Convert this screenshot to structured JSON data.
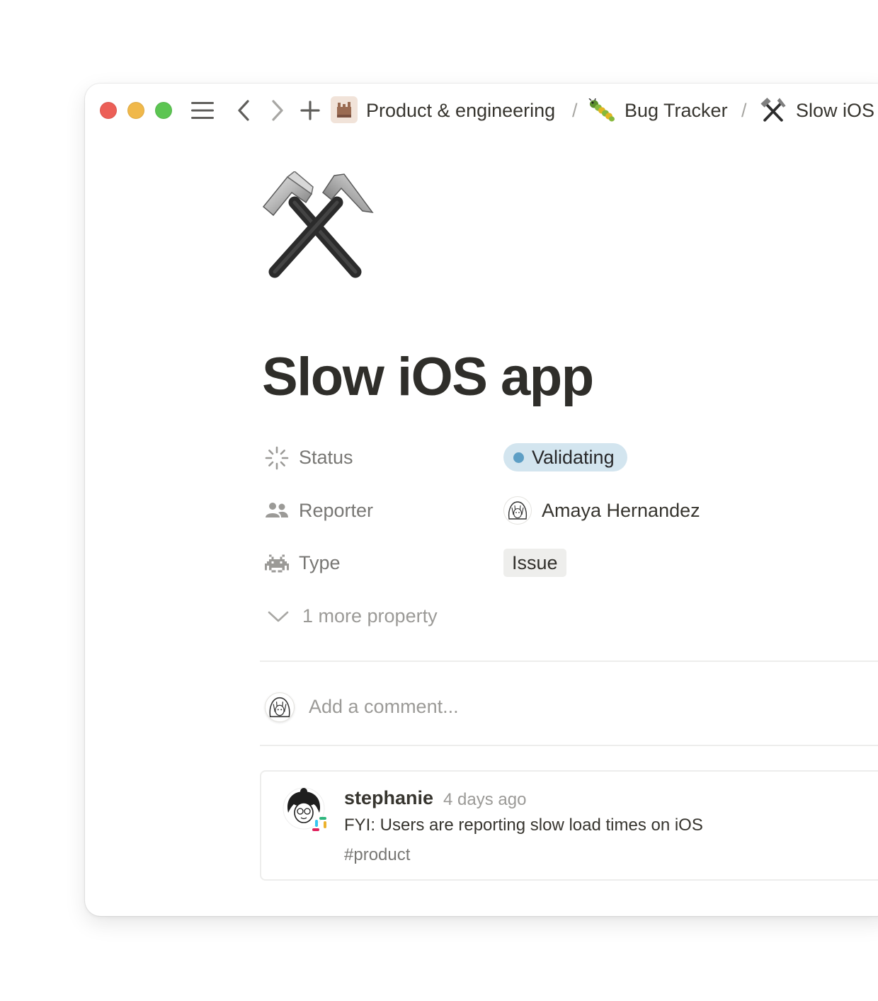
{
  "window": {
    "controls": [
      "close",
      "minimize",
      "zoom"
    ]
  },
  "toolbar": {
    "icons": [
      "menu-icon",
      "back-arrow-icon",
      "forward-arrow-icon",
      "plus-icon"
    ]
  },
  "breadcrumb": {
    "items": [
      {
        "label": "Product & engineering",
        "icon": "factory-icon"
      },
      {
        "label": "Bug Tracker",
        "icon": "bug-icon"
      },
      {
        "label": "Slow iOS",
        "icon": "hammer-pick-icon"
      }
    ],
    "separator": "/"
  },
  "page": {
    "icon": "hammer-pick-icon",
    "title": "Slow iOS app"
  },
  "properties": [
    {
      "label": "Status",
      "icon": "status-loader-icon",
      "value": "Validating",
      "kind": "status",
      "dot_color": "#5e9fc5",
      "pill_color": "#d3e5ef"
    },
    {
      "label": "Reporter",
      "icon": "people-icon",
      "value": "Amaya Hernandez",
      "kind": "person"
    },
    {
      "label": "Type",
      "icon": "space-invader-icon",
      "value": "Issue",
      "kind": "tag"
    }
  ],
  "more_properties": {
    "label": "1 more property",
    "icon": "chevron-down-icon"
  },
  "comment_input": {
    "placeholder": "Add a comment..."
  },
  "comments": [
    {
      "author": "stephanie",
      "time": "4 days ago",
      "text": "FYI: Users are reporting slow load times on iOS",
      "channel": "#product",
      "source_icon": "slack-icon"
    }
  ]
}
